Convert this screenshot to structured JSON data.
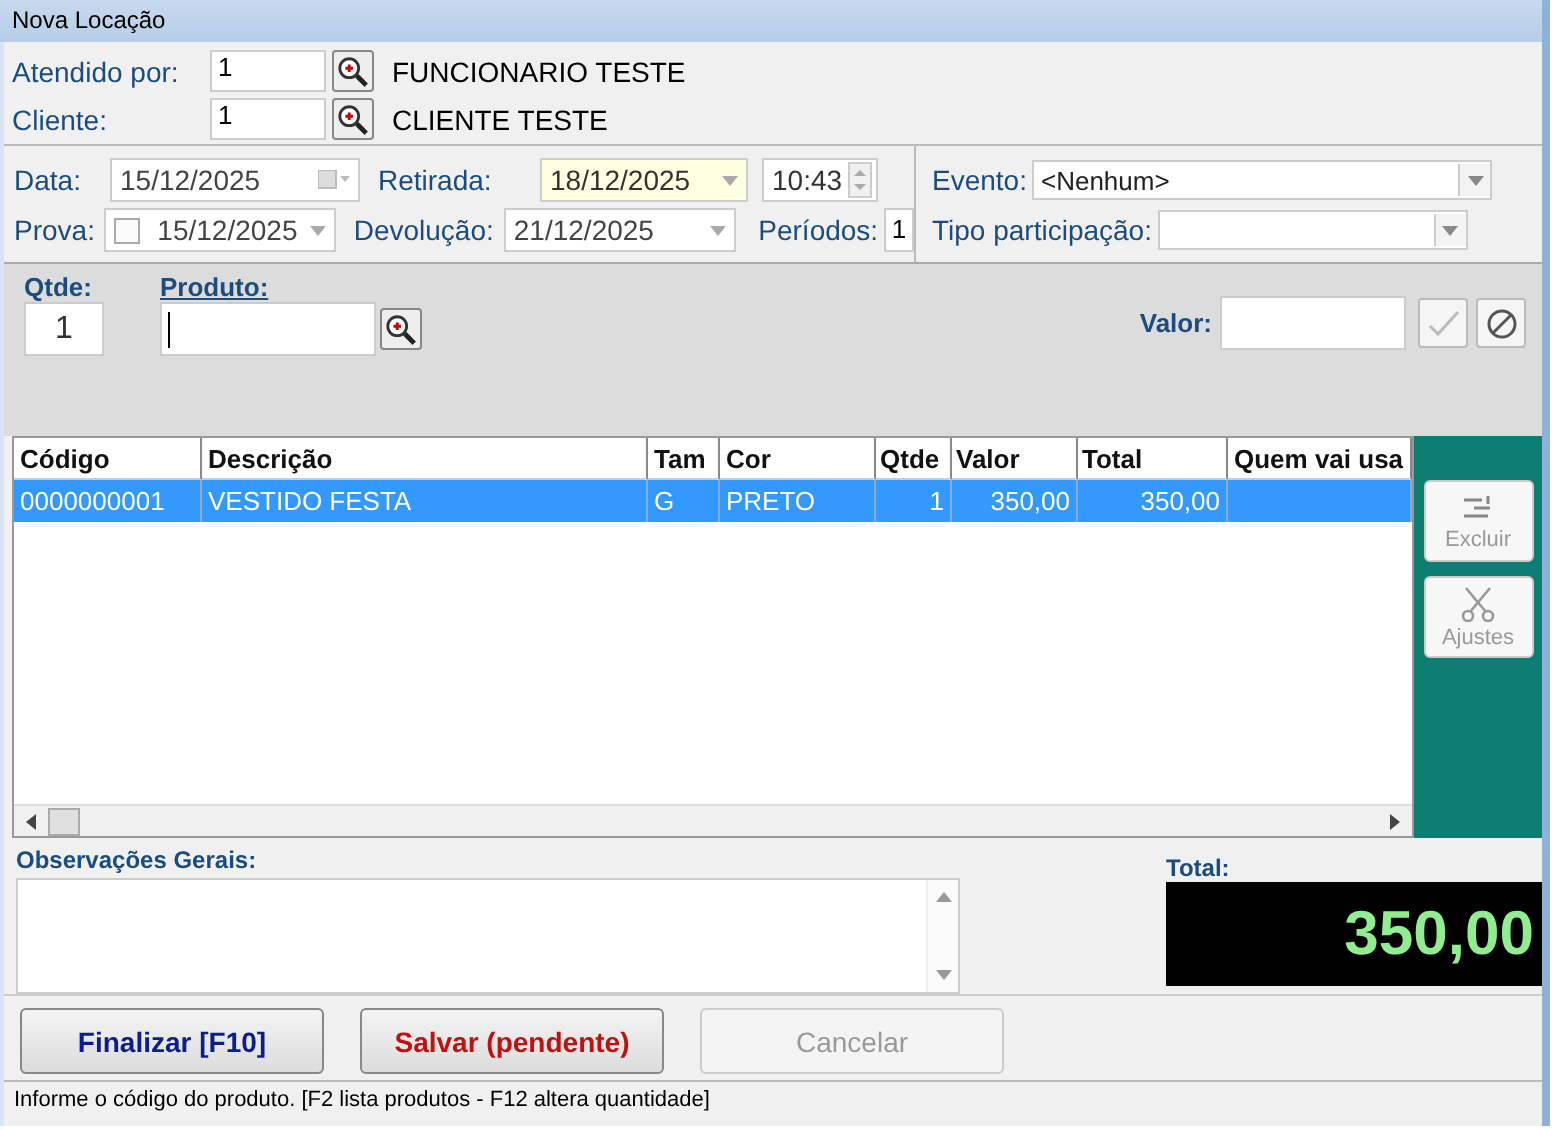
{
  "window": {
    "title": "Nova Locação"
  },
  "attendant": {
    "label": "Atendido por:",
    "code": "1",
    "name": "FUNCIONARIO TESTE"
  },
  "client": {
    "label": "Cliente:",
    "code": "1",
    "name": "CLIENTE TESTE"
  },
  "dates": {
    "data": {
      "label": "Data:",
      "value": "15/12/2025"
    },
    "prova": {
      "label": "Prova:",
      "value": "15/12/2025",
      "checked": false
    },
    "retirada": {
      "label": "Retirada:",
      "value": "18/12/2025",
      "time": "10:43"
    },
    "devolucao": {
      "label": "Devolução:",
      "value": "21/12/2025"
    },
    "periodos": {
      "label": "Períodos:",
      "value": "1"
    }
  },
  "event": {
    "label": "Evento:",
    "value": "<Nenhum>"
  },
  "participation": {
    "label": "Tipo participação:"
  },
  "product_entry": {
    "qty_label": "Qtde:",
    "qty": "1",
    "product_label": "Produto:",
    "price_label": "Valor:"
  },
  "table": {
    "columns": [
      {
        "label": "Código",
        "kind": "text"
      },
      {
        "label": "Descrição",
        "kind": "text"
      },
      {
        "label": "Tam",
        "kind": "text"
      },
      {
        "label": "Cor",
        "kind": "text"
      },
      {
        "label": "Qtde",
        "kind": "number"
      },
      {
        "label": "Valor",
        "kind": "number"
      },
      {
        "label": "Total",
        "kind": "number"
      },
      {
        "label": "Quem vai usa",
        "kind": "text"
      }
    ],
    "rows": [
      {
        "selected": true,
        "cells": [
          "0000000001",
          "VESTIDO FESTA",
          "G",
          "PRETO",
          "1",
          "350,00",
          "350,00",
          ""
        ]
      }
    ]
  },
  "side_buttons": [
    {
      "label": "Excluir",
      "kind": "delete",
      "disabled": true
    },
    {
      "label": "Ajustes",
      "kind": "scissors",
      "disabled": true
    }
  ],
  "notes": {
    "label": "Observações Gerais:"
  },
  "total": {
    "label": "Total:",
    "value": "350,00"
  },
  "buttons": [
    {
      "label": "Finalizar [F10]",
      "kind": "primary",
      "disabled": false
    },
    {
      "label": "Salvar (pendente)",
      "kind": "danger",
      "disabled": false
    },
    {
      "label": "Cancelar",
      "kind": "normal",
      "disabled": true
    }
  ],
  "status_bar": "Informe o código do produto. [F2 lista produtos - F12 altera quantidade]"
}
